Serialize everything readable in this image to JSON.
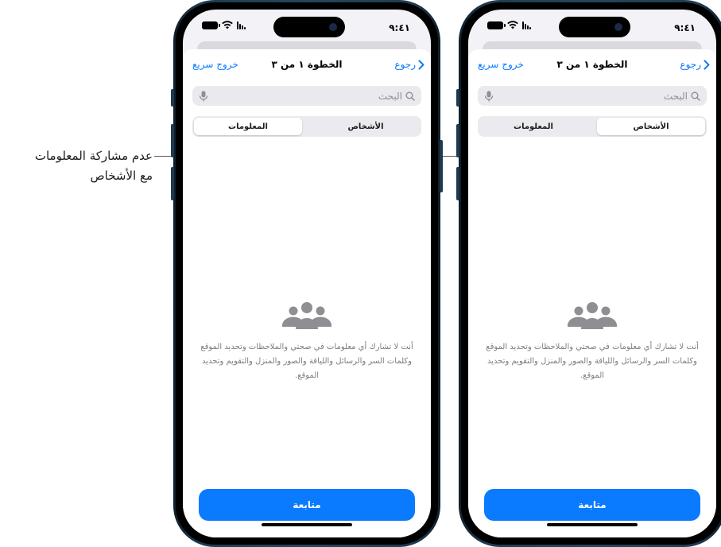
{
  "callout": {
    "line1": "عدم مشاركة المعلومات",
    "line2": "مع الأشخاص"
  },
  "phones": [
    {
      "time": "٩:٤١",
      "nav": {
        "back": "رجوع",
        "title": "الخطوة ١ من ٣",
        "quick_exit": "خروج سريع"
      },
      "search": {
        "placeholder": "البحث"
      },
      "segments": [
        "الأشخاص",
        "المعلومات"
      ],
      "selected_segment": "المعلومات",
      "empty_text": "أنت لا تشارك أي معلومات في صحتي والملاحظات وتحديد الموقع وكلمات السر والرسائل واللياقة والصور والمنزل والتقويم وتحديد الموقع.",
      "continue_label": "متابعة"
    },
    {
      "time": "٩:٤١",
      "nav": {
        "back": "رجوع",
        "title": "الخطوة ١ من ٣",
        "quick_exit": "خروج سريع"
      },
      "search": {
        "placeholder": "البحث"
      },
      "segments": [
        "الأشخاص",
        "المعلومات"
      ],
      "selected_segment": "الأشخاص",
      "empty_text": "أنت لا تشارك أي معلومات في صحتي والملاحظات وتحديد الموقع وكلمات السر والرسائل واللياقة والصور والمنزل والتقويم وتحديد الموقع.",
      "continue_label": "متابعة"
    }
  ],
  "colors": {
    "accent": "#0a7aff",
    "frame": "#1f3b52",
    "secondary_text": "#7c7c82"
  },
  "icons": [
    "chevron-right-icon",
    "search-icon",
    "microphone-icon",
    "people-group-icon",
    "wifi-icon",
    "cellular-signal-icon",
    "battery-icon"
  ]
}
